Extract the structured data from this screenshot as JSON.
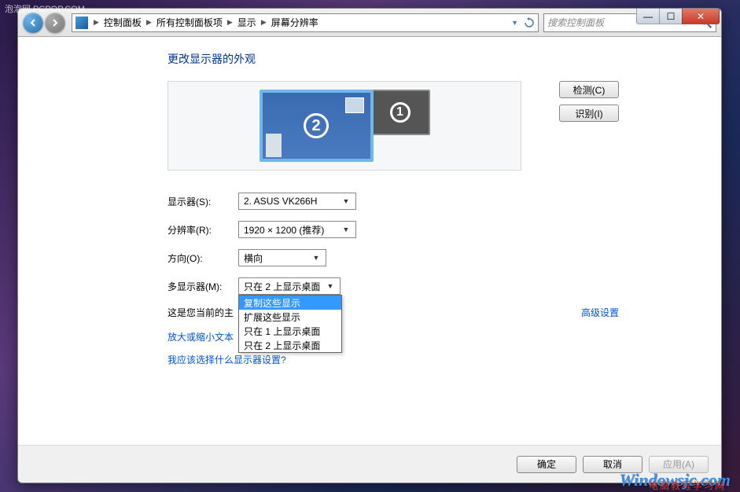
{
  "watermark": {
    "top": "泡泡网 PCPOP.COM",
    "bottom": "Windowsjc.com",
    "bottom2": "电脑教程学习网"
  },
  "window_controls": {
    "min": "―",
    "max": "☐",
    "close": "✕"
  },
  "breadcrumb": {
    "items": [
      "控制面板",
      "所有控制面板项",
      "显示",
      "屏幕分辨率"
    ],
    "sep": "▶"
  },
  "search": {
    "placeholder": "搜索控制面板"
  },
  "page_title": "更改显示器的外观",
  "monitors": {
    "primary": "2",
    "secondary": "1"
  },
  "side_buttons": {
    "detect": "检测(C)",
    "identify": "识别(I)"
  },
  "form": {
    "display_label": "显示器(S):",
    "display_value": "2. ASUS VK266H",
    "resolution_label": "分辨率(R):",
    "resolution_value": "1920 × 1200 (推荐)",
    "orientation_label": "方向(O):",
    "orientation_value": "横向",
    "multi_label": "多显示器(M):",
    "multi_value": "只在 2 上显示桌面",
    "multi_options": [
      "复制这些显示",
      "扩展这些显示",
      "只在 1 上显示桌面",
      "只在 2 上显示桌面"
    ],
    "multi_selected_index": 0
  },
  "info_text": "这是您当前的主",
  "links": {
    "zoom": "放大或缩小文本",
    "advanced": "高级设置",
    "help": "我应该选择什么显示器设置?"
  },
  "footer": {
    "ok": "确定",
    "cancel": "取消",
    "apply": "应用(A)"
  }
}
